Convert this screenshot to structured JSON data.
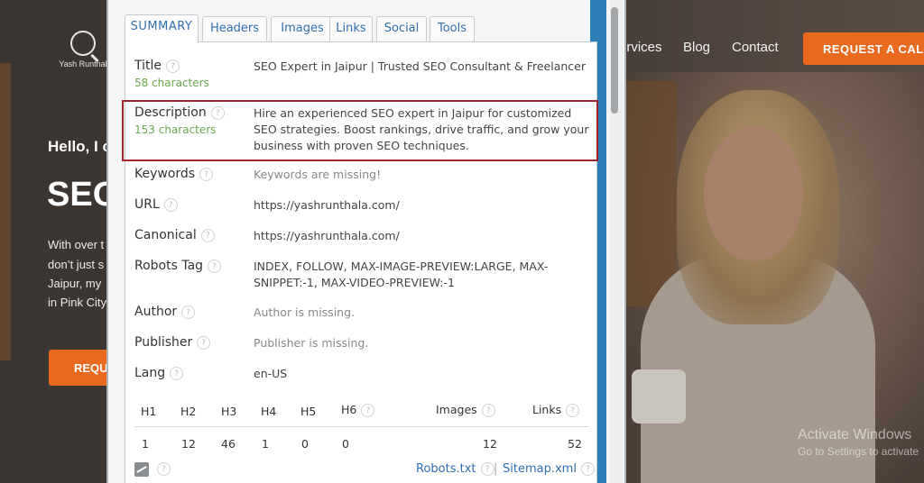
{
  "site": {
    "logo_text": "Yash Runthal",
    "nav": {
      "services": "ervices",
      "blog": "Blog",
      "contact": "Contact"
    },
    "cta": "REQUEST A CALL",
    "hello": "Hello, I c",
    "headline": "SEO",
    "para": [
      "With over t",
      "don’t just s",
      "Jaipur, my",
      "in Pink City"
    ],
    "hero_button": "REQU"
  },
  "watermark": {
    "title": "Activate Windows",
    "subtitle": "Go to Settings to activate"
  },
  "popup": {
    "tabs": [
      {
        "label": "SUMMARY",
        "active": true
      },
      {
        "label": "Headers"
      },
      {
        "label": "Images"
      },
      {
        "label": "Links"
      },
      {
        "label": "Social"
      },
      {
        "label": "Tools"
      }
    ],
    "help_glyph": "?",
    "rows": {
      "title": {
        "label": "Title",
        "count": "58 characters",
        "value": "SEO Expert in Jaipur | Trusted SEO Consultant & Freelancer"
      },
      "description": {
        "label": "Description",
        "count": "153 characters",
        "value": "Hire an experienced SEO expert in Jaipur for customized SEO strategies. Boost rankings, drive traffic, and grow your business with proven SEO techniques."
      },
      "keywords": {
        "label": "Keywords",
        "value": "Keywords are missing!"
      },
      "url": {
        "label": "URL",
        "value": "https://yashrunthala.com/"
      },
      "canonical": {
        "label": "Canonical",
        "value": "https://yashrunthala.com/"
      },
      "robots": {
        "label": "Robots Tag",
        "value": "INDEX, FOLLOW, MAX-IMAGE-PREVIEW:LARGE, MAX-SNIPPET:-1, MAX-VIDEO-PREVIEW:-1"
      },
      "author": {
        "label": "Author",
        "value": "Author is missing."
      },
      "publisher": {
        "label": "Publisher",
        "value": "Publisher is missing."
      },
      "lang": {
        "label": "Lang",
        "value": "en-US"
      }
    },
    "headings": {
      "labels": {
        "h1": "H1",
        "h2": "H2",
        "h3": "H3",
        "h4": "H4",
        "h5": "H5",
        "h6": "H6",
        "images": "Images",
        "links": "Links"
      },
      "values": {
        "h1": "1",
        "h2": "12",
        "h3": "46",
        "h4": "1",
        "h5": "0",
        "h6": "0",
        "images": "12",
        "links": "52"
      }
    },
    "footer": {
      "robots": "Robots.txt",
      "separator": "|",
      "sitemap": "Sitemap.xml"
    }
  }
}
